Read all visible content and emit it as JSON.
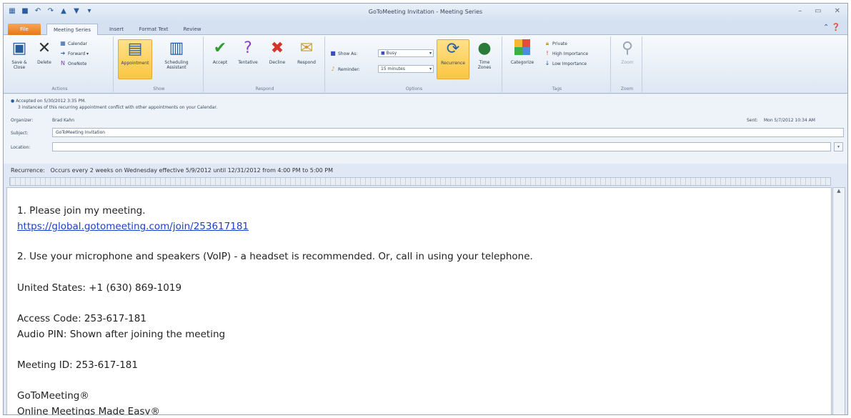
{
  "window": {
    "title": "GoToMeeting Invitation  -  Meeting Series",
    "qat_icons": [
      "outlook-icon",
      "save-icon",
      "undo-icon",
      "redo-icon",
      "up-arrow-icon",
      "down-arrow-icon",
      "customize-icon"
    ]
  },
  "tabs": [
    {
      "label": "File"
    },
    {
      "label": "Meeting Series"
    },
    {
      "label": "Insert"
    },
    {
      "label": "Format Text"
    },
    {
      "label": "Review"
    }
  ],
  "ribbon": {
    "actions": {
      "save_close": "Save & Close",
      "delete": "Delete",
      "calendar": "Calendar",
      "forward": "Forward",
      "onenote": "OneNote",
      "group": "Actions"
    },
    "show": {
      "appointment": "Appointment",
      "scheduling": "Scheduling Assistant",
      "group": "Show"
    },
    "respond": {
      "accept": "Accept",
      "tentative": "Tentative",
      "decline": "Decline",
      "respond": "Respond",
      "group": "Respond"
    },
    "options": {
      "show_as_label": "Show As:",
      "show_as_value": "Busy",
      "reminder_label": "Reminder:",
      "reminder_value": "15 minutes",
      "recurrence": "Recurrence",
      "time_zones": "Time Zones",
      "group": "Options"
    },
    "tags": {
      "categorize": "Categorize",
      "private": "Private",
      "high": "High Importance",
      "low": "Low Importance",
      "group": "Tags"
    },
    "zoom": {
      "zoom": "Zoom",
      "group": "Zoom"
    }
  },
  "info": {
    "accepted": "Accepted on 5/30/2012 3:35 PM.",
    "conflict": "3 instances of this recurring appointment conflict with other appointments on your Calendar.",
    "organizer_label": "Organizer:",
    "organizer": "Brad Kahn",
    "sent_label": "Sent:",
    "sent": "Mon 5/7/2012 10:34 AM",
    "subject_label": "Subject:",
    "subject": "GoToMeeting Invitation",
    "location_label": "Location:",
    "location": "",
    "recurrence_label": "Recurrence:",
    "recurrence": "Occurs every 2 weeks on Wednesday effective 5/9/2012 until 12/31/2012 from 4:00 PM to 5:00 PM"
  },
  "body": {
    "l1": "1.  Please join my meeting.",
    "link": "https://global.gotomeeting.com/join/253617181",
    "l2": "2.  Use your microphone and speakers (VoIP) - a headset is recommended.  Or, call in using your telephone.",
    "l3": "United States: +1 (630) 869-1019",
    "l4": "Access Code: 253-617-181",
    "l5": "Audio PIN: Shown after joining the meeting",
    "l6": "Meeting ID: 253-617-181",
    "l7": "GoToMeeting®",
    "l8": "Online Meetings Made Easy®"
  },
  "colors": {
    "file_tab": "#e77817",
    "selected_button": "#fbc640",
    "link": "#1a3fcc",
    "accept_check": "#2f9e2f",
    "decline_x": "#d8332a",
    "tentative": "#8a3fc7"
  }
}
